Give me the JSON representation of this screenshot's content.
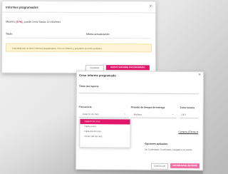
{
  "back_dialog": {
    "title": "Informes programados",
    "intro_prefix": "Máximo ",
    "intro_highlight": "(0 %),",
    "intro_rest": " puede crear hasta 10 informes",
    "columns": [
      "Título",
      "Última actualización"
    ],
    "empty_message": "Esta tabla aún no tiene informes programados. Cree un informe y programe su envío periódico.",
    "cancel_label": "CERRAR",
    "new_label": "NUEVO INFORME PROGRAMADO"
  },
  "front_dialog": {
    "title": "Crear informe programado",
    "report_title_label": "Título del reporte",
    "frequency_label": "Frecuencia",
    "frequency_value": "Cada fin de mes",
    "delivery_label": "Período de tiempo de entrega",
    "delivery_value": "Mañana",
    "time_label": "Zona horaria",
    "time_value": "CET",
    "frequency_options": [
      "Cada fin de mes",
      "Cada Lunes",
      "Cada día del mes",
      "Primer día del mes"
    ],
    "columns_link": "Campos (Filtros)",
    "applied_options_label": "Opciones aplicadas",
    "applied_options_value": "No Confirmado, Confirmado, Cargado a la Cliente",
    "cancel_label": "CANCELAR",
    "ok_label": "PROGRAMAR INFORME"
  },
  "colors": {
    "accent": "#e0176a",
    "accent_light": "#f06fa3"
  }
}
